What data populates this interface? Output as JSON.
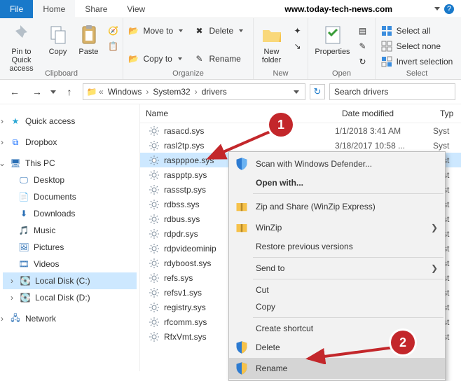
{
  "title_tabs": {
    "file": "File",
    "home": "Home",
    "share": "Share",
    "view": "View"
  },
  "watermark": "www.today-tech-news.com",
  "ribbon": {
    "clipboard": {
      "label": "Clipboard",
      "pin": "Pin to Quick access",
      "copy": "Copy",
      "paste": "Paste"
    },
    "organize": {
      "label": "Organize",
      "moveto": "Move to",
      "copyto": "Copy to",
      "delete": "Delete",
      "rename": "Rename"
    },
    "new": {
      "label": "New",
      "newfolder": "New folder"
    },
    "open": {
      "label": "Open",
      "properties": "Properties"
    },
    "select": {
      "label": "Select",
      "all": "Select all",
      "none": "Select none",
      "invert": "Invert selection"
    }
  },
  "breadcrumbs": [
    "Windows",
    "System32",
    "drivers"
  ],
  "search_placeholder": "Search drivers",
  "nav": {
    "quick": "Quick access",
    "dropbox": "Dropbox",
    "thispc": "This PC",
    "desktop": "Desktop",
    "documents": "Documents",
    "downloads": "Downloads",
    "music": "Music",
    "pictures": "Pictures",
    "videos": "Videos",
    "diskc": "Local Disk (C:)",
    "diskd": "Local Disk (D:)",
    "network": "Network"
  },
  "columns": {
    "name": "Name",
    "date": "Date modified",
    "type": "Typ"
  },
  "files": [
    {
      "name": "rasacd.sys",
      "date": "1/1/2018 3:41 AM",
      "type": "Syst"
    },
    {
      "name": "rasl2tp.sys",
      "date": "3/18/2017 10:58 ...",
      "type": "Syst"
    },
    {
      "name": "raspppoe.sys",
      "date": "",
      "type": "Syst",
      "selected": true
    },
    {
      "name": "raspptp.sys",
      "date": "",
      "type": "Syst"
    },
    {
      "name": "rassstp.sys",
      "date": "",
      "type": "Syst"
    },
    {
      "name": "rdbss.sys",
      "date": "",
      "type": "Syst"
    },
    {
      "name": "rdbus.sys",
      "date": "",
      "type": "Syst"
    },
    {
      "name": "rdpdr.sys",
      "date": "",
      "type": "Syst"
    },
    {
      "name": "rdpvideominip",
      "date": "",
      "type": "Syst"
    },
    {
      "name": "rdyboost.sys",
      "date": "",
      "type": "Syst"
    },
    {
      "name": "refs.sys",
      "date": "",
      "type": "Syst"
    },
    {
      "name": "refsv1.sys",
      "date": "",
      "type": "Syst"
    },
    {
      "name": "registry.sys",
      "date": "",
      "type": "Syst"
    },
    {
      "name": "rfcomm.sys",
      "date": "",
      "type": "Syst"
    },
    {
      "name": "RfxVmt.sys",
      "date": "",
      "type": "Syst"
    }
  ],
  "context": [
    {
      "icon": "shield",
      "label": "Scan with Windows Defender..."
    },
    {
      "bold": true,
      "label": "Open with..."
    },
    {
      "sep": true
    },
    {
      "icon": "zip",
      "label": "Zip and Share (WinZip Express)"
    },
    {
      "icon": "zip",
      "label": "WinZip",
      "sub": true
    },
    {
      "label": "Restore previous versions"
    },
    {
      "sep": true
    },
    {
      "label": "Send to",
      "sub": true
    },
    {
      "sep": true
    },
    {
      "label": "Cut"
    },
    {
      "label": "Copy"
    },
    {
      "sep": true
    },
    {
      "label": "Create shortcut"
    },
    {
      "icon": "uac",
      "label": "Delete"
    },
    {
      "icon": "uac",
      "label": "Rename",
      "hover": true
    }
  ],
  "badges": {
    "one": "1",
    "two": "2"
  }
}
